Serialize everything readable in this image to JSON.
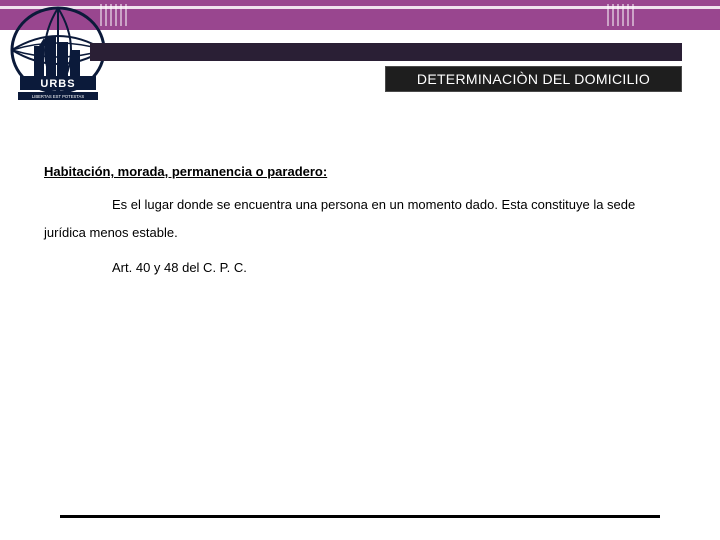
{
  "header": {
    "title": "DETERMINACIÒN DEL DOMICILIO"
  },
  "body": {
    "heading": "Habitación, morada, permanencia o paradero:",
    "paragraph": "Es el lugar donde se encuentra una persona en un momento dado. Esta constituye la sede jurídica menos estable.",
    "legal_reference": "Art. 40 y 48 del C. P. C."
  },
  "logo": {
    "name": "URBS",
    "motto": "LIBERTAS EST POTESTAS"
  },
  "colors": {
    "brand_purple": "#99468f",
    "dark_band": "#2a1f35",
    "pill_bg": "#1e1e1e"
  }
}
